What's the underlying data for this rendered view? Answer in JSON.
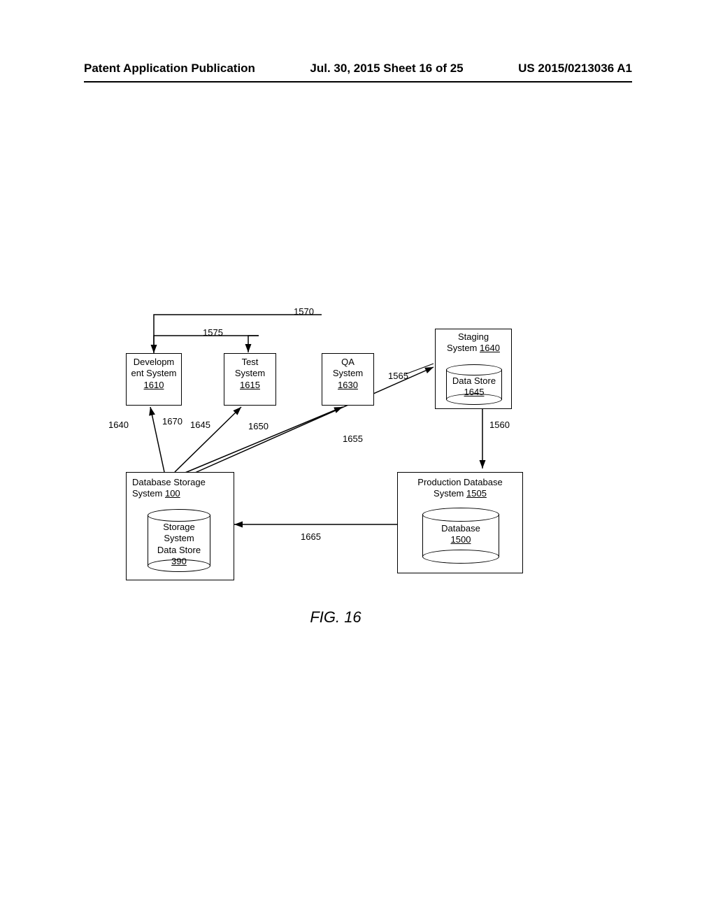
{
  "header": {
    "left": "Patent Application Publication",
    "center": "Jul. 30, 2015  Sheet 16 of 25",
    "right": "US 2015/0213036 A1"
  },
  "boxes": {
    "dev": {
      "label": "Developm\nent System",
      "ref": "1610"
    },
    "test": {
      "label": "Test\nSystem",
      "ref": "1615"
    },
    "qa": {
      "label": "QA\nSystem",
      "ref": "1630"
    },
    "staging": {
      "label": "Staging\nSystem",
      "ref": "1640"
    },
    "datastore": {
      "label": "Data Store",
      "ref": "1645"
    },
    "dbss": {
      "label": "Database Storage\nSystem",
      "ref": "100"
    },
    "ssds": {
      "label": "Storage\nSystem\nData Store",
      "ref": "390"
    },
    "prod": {
      "label": "Production Database\nSystem",
      "ref": "1505"
    },
    "database": {
      "label": "Database",
      "ref": "1500"
    }
  },
  "labels": {
    "l1570": "1570",
    "l1575": "1575",
    "l1565": "1565",
    "l1640": "1640",
    "l1670": "1670",
    "l1645": "1645",
    "l1650": "1650",
    "l1655": "1655",
    "l1560": "1560",
    "l1665": "1665"
  },
  "caption": "FIG. 16"
}
